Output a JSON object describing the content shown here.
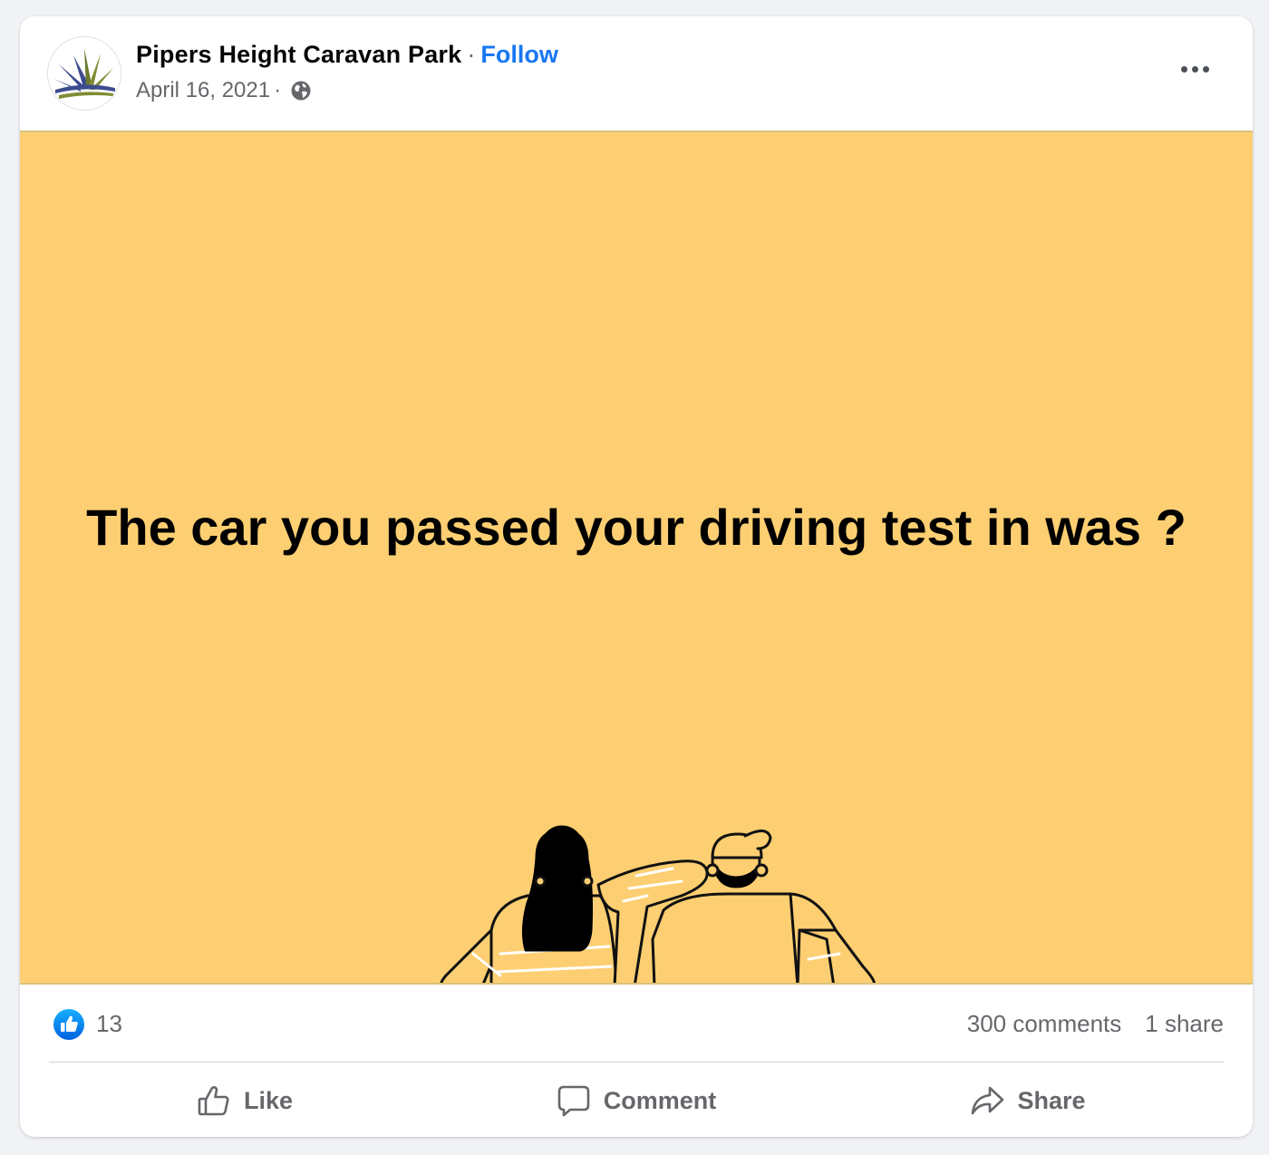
{
  "post": {
    "page_name": "Pipers Height Caravan Park",
    "separator": "·",
    "follow_label": "Follow",
    "date": "April 16, 2021",
    "date_separator": "·",
    "audience_icon": "globe-icon",
    "more_icon": "more-options-icon",
    "image_text": "The car you passed your driving test in was ?",
    "image_background": "#fdcf72"
  },
  "stats": {
    "reaction_icon": "like-reaction-icon",
    "reaction_count": "13",
    "comments": "300 comments",
    "shares": "1 share"
  },
  "actions": [
    {
      "label": "Like",
      "icon": "thumbs-up-icon"
    },
    {
      "label": "Comment",
      "icon": "comment-bubble-icon"
    },
    {
      "label": "Share",
      "icon": "share-arrow-icon"
    }
  ],
  "colors": {
    "link_blue": "#1877f2",
    "secondary_text": "#65676b",
    "card_bg": "#ffffff",
    "page_bg": "#f0f2f5"
  }
}
